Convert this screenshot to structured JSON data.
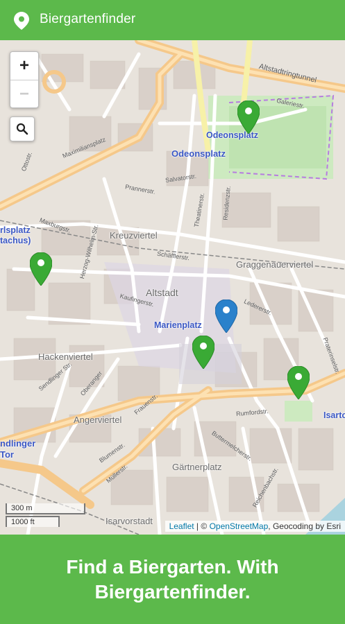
{
  "app": {
    "title": "Biergartenfinder",
    "accent_color": "#5cb94b",
    "icon": "location-pin-icon"
  },
  "map": {
    "zoom_in_label": "+",
    "zoom_out_label": "−",
    "search_icon": "search-icon",
    "districts": [
      "Kreuzviertel",
      "Altstadt",
      "Graggenauerviertel",
      "Hackenviertel",
      "Angerviertel",
      "Gärtnerplatz",
      "Isarvorstadt"
    ],
    "stations": [
      "Odeonsplatz",
      "Odeonsplatz",
      "Marienplatz",
      "rlsplatz",
      "tachus)",
      "ndlinger",
      "Tor",
      "Isarto"
    ],
    "streets": [
      "Maximiliansplatz",
      "Prannerstr.",
      "Salvatorstr.",
      "Theatinerstr.",
      "Residenzstr.",
      "Kaufingerstr.",
      "Sendlinger Str.",
      "Oberanger",
      "Blumenstr.",
      "Rumfordstr.",
      "Herzog-Wilhelm-Str.",
      "Altstadtringtunnel",
      "Galeriestr.",
      "Schäfflerstr.",
      "Ledererstr.",
      "Maxburgstr.",
      "Ottostr.",
      "Müllerstr.",
      "Frauenstr.",
      "Praterinselstr.",
      "Buttermelcherstr.",
      "Reichenbachstr."
    ],
    "markers": [
      {
        "type": "beer-garden",
        "color": "#3aaa35"
      },
      {
        "type": "beer-garden",
        "color": "#3aaa35"
      },
      {
        "type": "beer-garden",
        "color": "#3aaa35"
      },
      {
        "type": "beer-garden",
        "color": "#3aaa35"
      },
      {
        "type": "current-location",
        "color": "#2a81cb"
      }
    ],
    "scale_metric": "300 m",
    "scale_imperial": "1000 ft",
    "attribution": {
      "leaflet": "Leaflet",
      "separator": " | © ",
      "osm": "OpenStreetMap",
      "geocoding": ", Geocoding by Esri"
    }
  },
  "banner": {
    "text": "Find a Biergarten. With Biergartenfinder."
  }
}
